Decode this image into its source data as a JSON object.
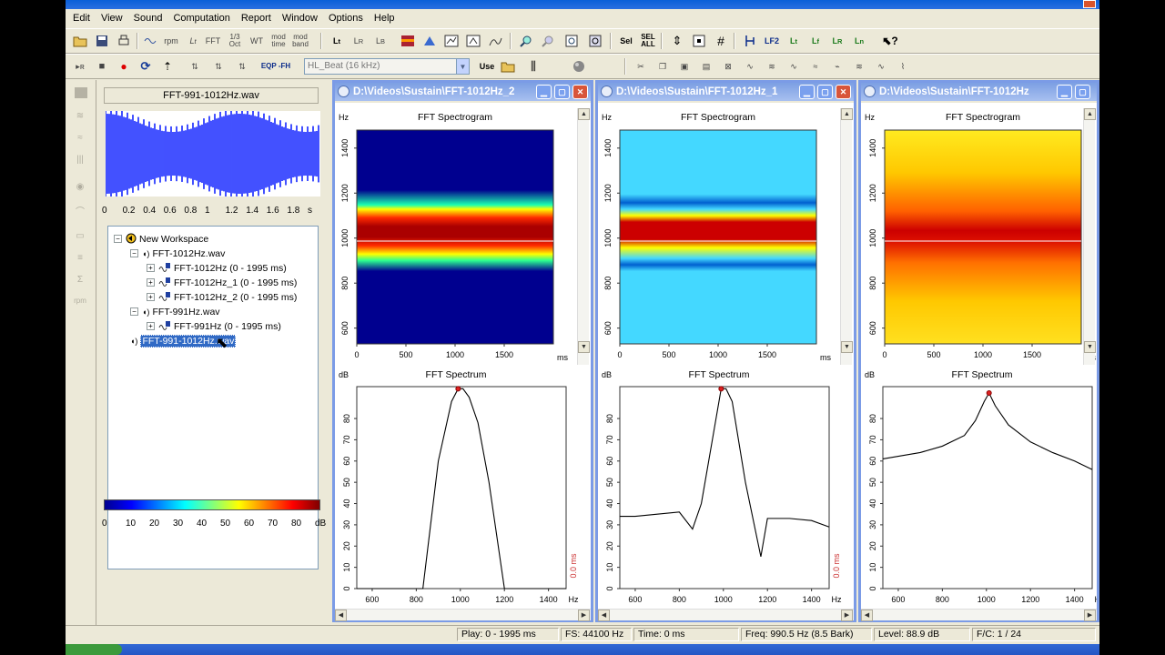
{
  "menu": [
    "Edit",
    "View",
    "Sound",
    "Computation",
    "Report",
    "Window",
    "Options",
    "Help"
  ],
  "toolbar": {
    "labels": {
      "rpm": "rpm",
      "fft": "FFT",
      "oct": "1/3 Oct",
      "wt": "WT",
      "modtime": "mod time",
      "modband": "mod band",
      "sel": "Sel",
      "selall": "SEL ALL",
      "lf2": "LF2",
      "eqp": "EQP -FH",
      "use": "Use"
    },
    "filter_value": "HL_Beat (16 kHz)"
  },
  "left_panel": {
    "wave_title": "FFT-991-1012Hz.wav",
    "wave_ticks": [
      "0",
      "0.2",
      "0.4",
      "0.6",
      "0.8",
      "1",
      "1.2",
      "1.4",
      "1.6",
      "1.8",
      "s"
    ],
    "tree": [
      {
        "level": 0,
        "label": "New Workspace",
        "expander": "−"
      },
      {
        "level": 1,
        "label": "FFT-1012Hz.wav",
        "expander": "−"
      },
      {
        "level": 2,
        "label": "FFT-1012Hz  (0 - 1995 ms)",
        "expander": "+"
      },
      {
        "level": 2,
        "label": "FFT-1012Hz_1  (0 - 1995 ms)",
        "expander": "+"
      },
      {
        "level": 2,
        "label": "FFT-1012Hz_2  (0 - 1995 ms)",
        "expander": "+"
      },
      {
        "level": 1,
        "label": "FFT-991Hz.wav",
        "expander": "−"
      },
      {
        "level": 2,
        "label": "FFT-991Hz  (0 - 1995 ms)",
        "expander": "+"
      },
      {
        "level": 1,
        "label": "FFT-991-1012Hz.wav",
        "expander": "",
        "selected": true
      }
    ],
    "colorbar_ticks": [
      "0",
      "10",
      "20",
      "30",
      "40",
      "50",
      "60",
      "70",
      "80",
      "dB"
    ]
  },
  "windows": [
    {
      "title": "D:\\Videos\\Sustain\\FFT-1012Hz_2",
      "spec_title": "FFT Spectrogram",
      "spectrum_title": "FFT Spectrum",
      "side_label": "0.0 ms",
      "close_red": true
    },
    {
      "title": "D:\\Videos\\Sustain\\FFT-1012Hz_1",
      "spec_title": "FFT Spectrogram",
      "spectrum_title": "FFT Spectrum",
      "side_label": "0.0 ms",
      "close_red": true
    },
    {
      "title": "D:\\Videos\\Sustain\\FFT-1012Hz",
      "spec_title": "FFT Spectrogram",
      "spectrum_title": "FFT Spectrum",
      "side_label": "",
      "close_red": false
    }
  ],
  "axes": {
    "spec_y_unit": "Hz",
    "spec_x_unit": "ms",
    "spec_y_ticks": [
      "600",
      "800",
      "1000",
      "1200",
      "1400"
    ],
    "spec_x_ticks": [
      "0",
      "500",
      "1000",
      "1500"
    ],
    "spectrum_y_unit": "dB",
    "spectrum_x_unit": "Hz",
    "spectrum_y_ticks": [
      "0",
      "10",
      "20",
      "30",
      "40",
      "50",
      "60",
      "70",
      "80"
    ],
    "spectrum_x_ticks": [
      "600",
      "800",
      "1000",
      "1200",
      "1400"
    ]
  },
  "chart_data": [
    {
      "type": "line",
      "title": "FFT Spectrum",
      "xlabel": "Hz",
      "ylabel": "dB",
      "xlim": [
        530,
        1480
      ],
      "ylim": [
        0,
        95
      ],
      "series": [
        {
          "x": [
            530,
            830,
            900,
            960,
            990,
            1012,
            1040,
            1080,
            1130,
            1200,
            1480
          ],
          "values": [
            0,
            0,
            60,
            88,
            94,
            94,
            90,
            78,
            50,
            0,
            0
          ]
        }
      ]
    },
    {
      "type": "line",
      "title": "FFT Spectrum",
      "xlabel": "Hz",
      "ylabel": "dB",
      "xlim": [
        530,
        1480
      ],
      "ylim": [
        0,
        95
      ],
      "series": [
        {
          "x": [
            530,
            600,
            700,
            800,
            860,
            900,
            950,
            990,
            1012,
            1040,
            1100,
            1170,
            1200,
            1300,
            1400,
            1480
          ],
          "values": [
            34,
            34,
            35,
            36,
            28,
            40,
            70,
            94,
            94,
            88,
            50,
            15,
            33,
            33,
            32,
            29
          ]
        }
      ]
    },
    {
      "type": "line",
      "title": "FFT Spectrum",
      "xlabel": "Hz",
      "ylabel": "dB",
      "xlim": [
        530,
        1480
      ],
      "ylim": [
        0,
        95
      ],
      "series": [
        {
          "x": [
            530,
            700,
            800,
            900,
            950,
            990,
            1012,
            1040,
            1100,
            1200,
            1300,
            1400,
            1480
          ],
          "values": [
            61,
            64,
            67,
            72,
            79,
            88,
            92,
            86,
            77,
            69,
            64,
            60,
            56
          ]
        }
      ]
    }
  ],
  "status": {
    "play": "Play: 0 - 1995 ms",
    "fs": "FS: 44100 Hz",
    "time": "Time: 0 ms",
    "freq": "Freq: 990.5 Hz (8.5 Bark)",
    "level": "Level: 88.9 dB",
    "fc": "F/C: 1 / 24"
  }
}
